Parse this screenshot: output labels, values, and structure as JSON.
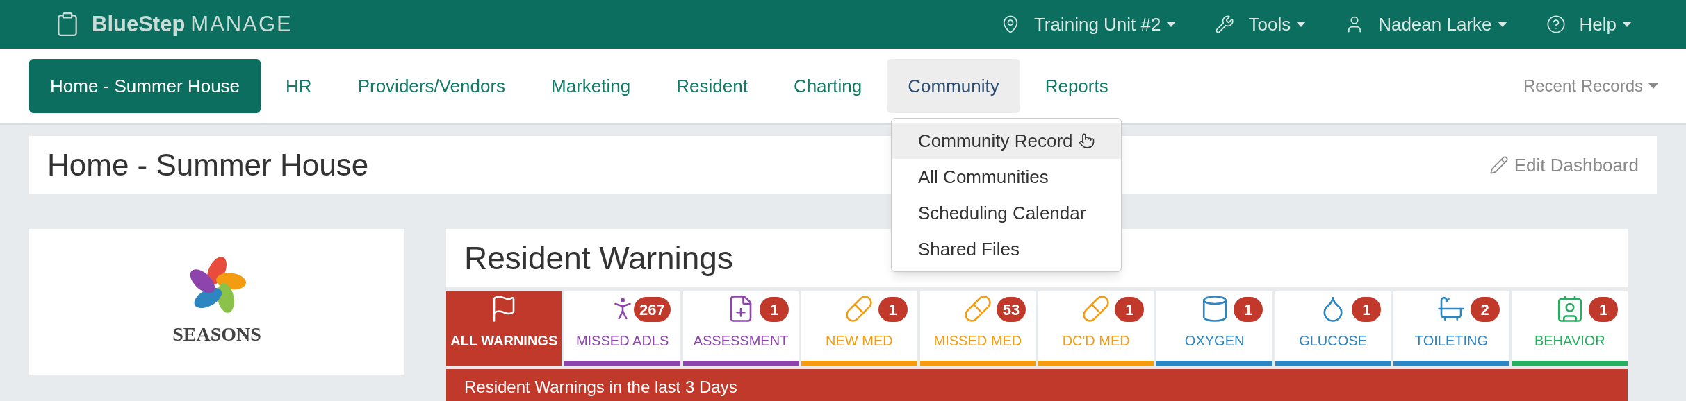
{
  "top_bar": {
    "brand": {
      "name": "BlueStep",
      "product": "MANAGE"
    },
    "menus": [
      {
        "label": "Training Unit #2"
      },
      {
        "label": "Tools"
      },
      {
        "label": "Nadean Larke"
      },
      {
        "label": "Help"
      }
    ]
  },
  "nav": {
    "tabs": [
      {
        "label": "Home - Summer House",
        "selected": true,
        "open": false
      },
      {
        "label": "HR",
        "selected": false,
        "open": false
      },
      {
        "label": "Providers/Vendors",
        "selected": false,
        "open": false
      },
      {
        "label": "Marketing",
        "selected": false,
        "open": false
      },
      {
        "label": "Resident",
        "selected": false,
        "open": false
      },
      {
        "label": "Charting",
        "selected": false,
        "open": false
      },
      {
        "label": "Community",
        "selected": false,
        "open": true
      },
      {
        "label": "Reports",
        "selected": false,
        "open": false
      }
    ],
    "recent": "Recent Records"
  },
  "dropdown": {
    "items": [
      {
        "label": "Community Record",
        "hovered": true
      },
      {
        "label": "All Communities",
        "hovered": false
      },
      {
        "label": "Scheduling Calendar",
        "hovered": false
      },
      {
        "label": "Shared Files",
        "hovered": false
      }
    ]
  },
  "page_title": "Home - Summer House",
  "edit_dashboard": "Edit Dashboard",
  "logo_card": {
    "name": "SEASONS"
  },
  "warnings": {
    "title": "Resident Warnings",
    "tiles": [
      {
        "label": "ALL WARNINGS",
        "selected": true,
        "color": "#c0392b"
      },
      {
        "label": "MISSED ADLS",
        "count": "267",
        "selected": false,
        "color": "#8e44ad"
      },
      {
        "label": "ASSESSMENT",
        "count": "1",
        "selected": false,
        "color": "#8e44ad"
      },
      {
        "label": "NEW MED",
        "count": "1",
        "selected": false,
        "color": "#f39c12"
      },
      {
        "label": "MISSED MED",
        "count": "53",
        "selected": false,
        "color": "#f39c12"
      },
      {
        "label": "DC'D MED",
        "count": "1",
        "selected": false,
        "color": "#f39c12"
      },
      {
        "label": "OXYGEN",
        "count": "1",
        "selected": false,
        "color": "#2e86c1"
      },
      {
        "label": "GLUCOSE",
        "count": "1",
        "selected": false,
        "color": "#2e86c1"
      },
      {
        "label": "TOILETING",
        "count": "2",
        "selected": false,
        "color": "#2e86c1"
      },
      {
        "label": "BEHAVIOR",
        "count": "1",
        "selected": false,
        "color": "#27ae60"
      }
    ],
    "banner": "Resident Warnings in the last 3 Days"
  }
}
